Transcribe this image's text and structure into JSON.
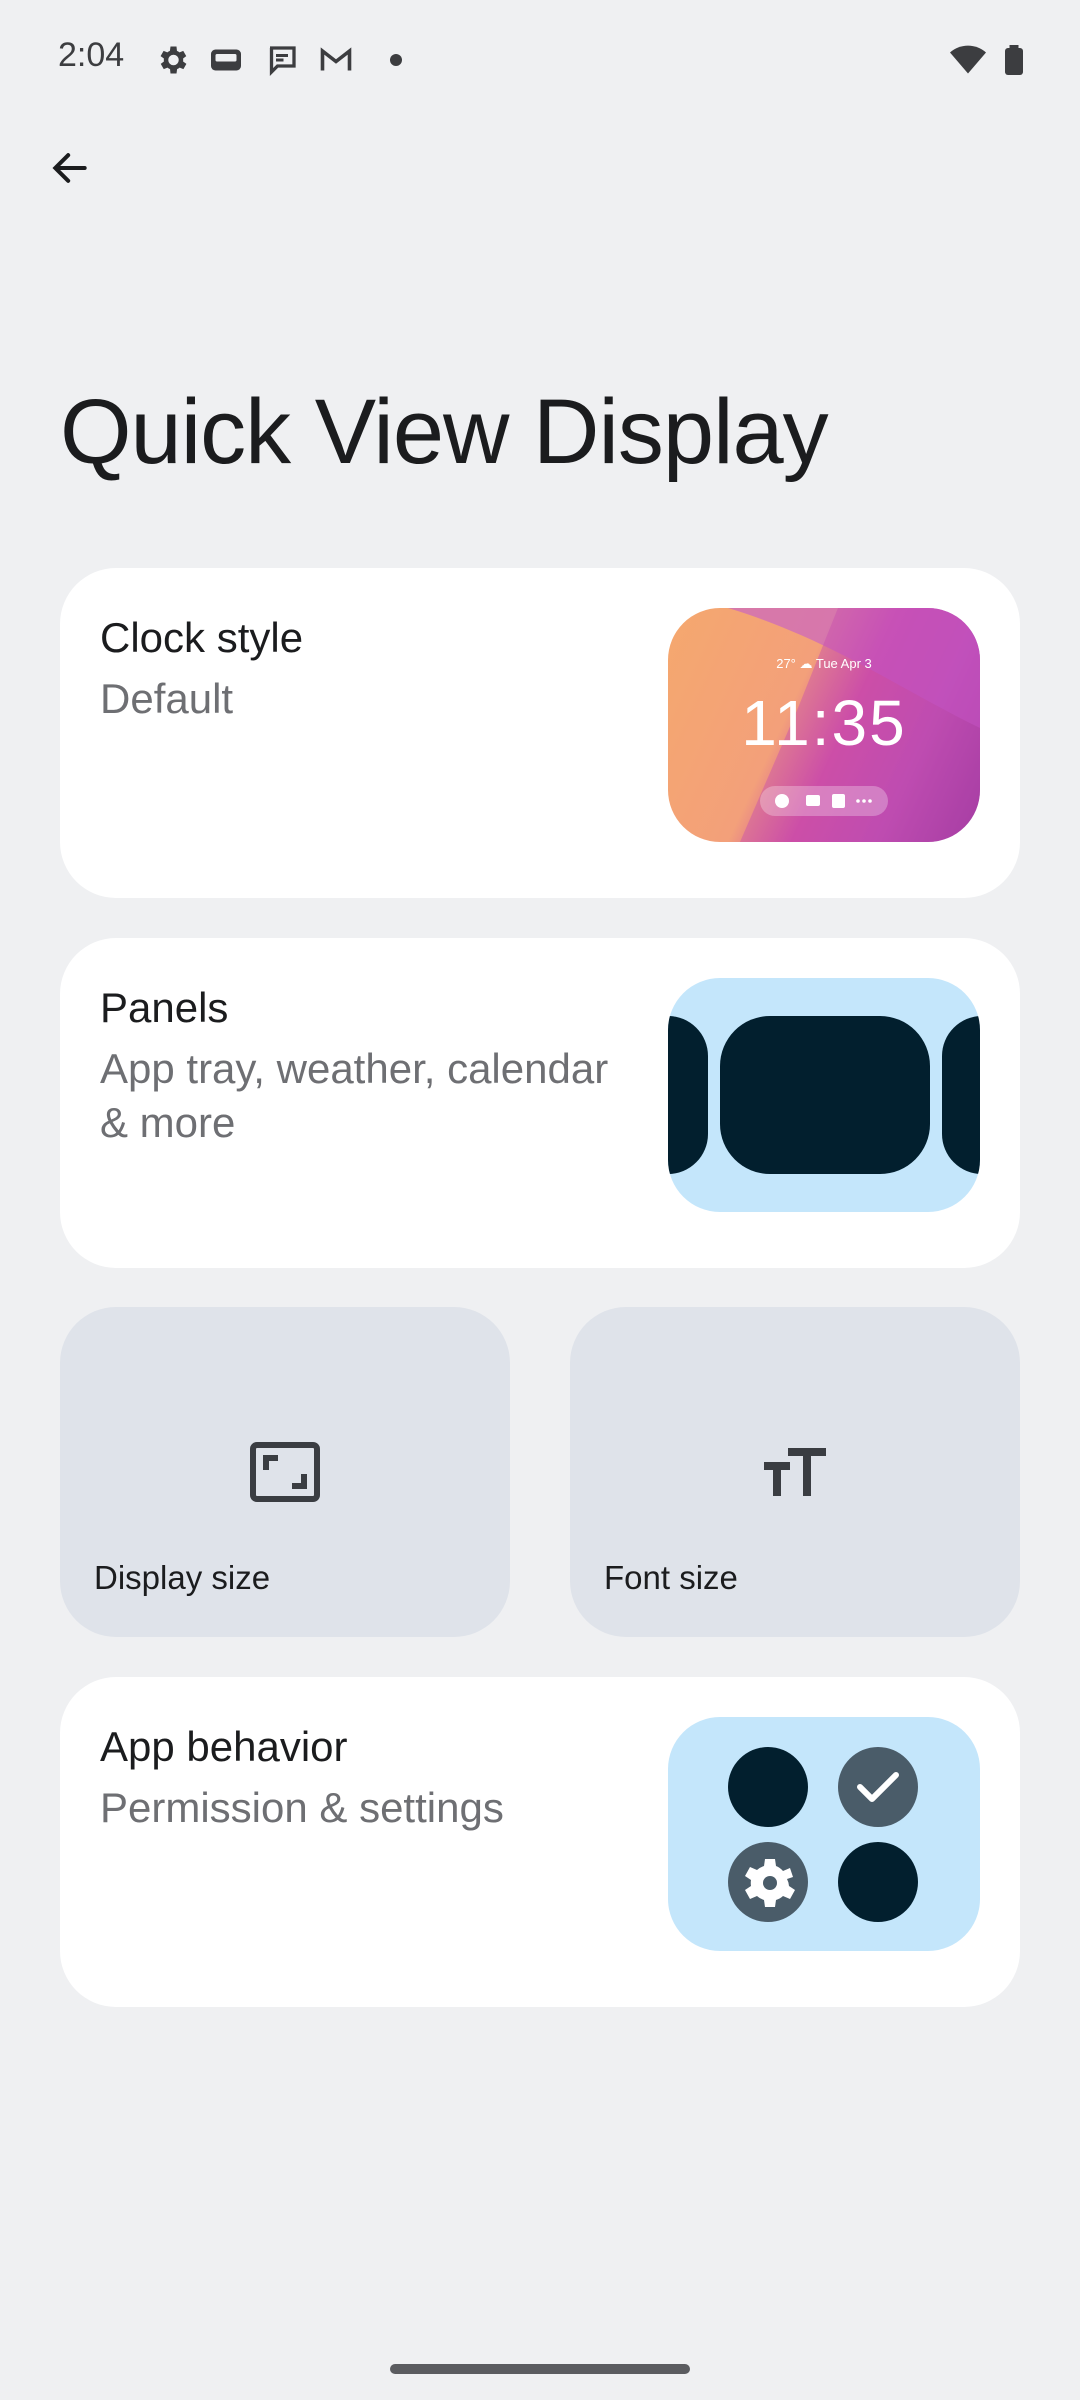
{
  "status_bar": {
    "time": "2:04",
    "icons": [
      "settings-icon",
      "cast-icon",
      "chat-icon",
      "gmail-icon",
      "dot-icon",
      "wifi-icon",
      "battery-icon"
    ]
  },
  "header": {
    "title": "Quick View Display"
  },
  "cards": {
    "clock_style": {
      "title": "Clock style",
      "subtitle": "Default",
      "preview": {
        "date": "27° ☁ Tue Apr 3",
        "time": "11:35"
      }
    },
    "panels": {
      "title": "Panels",
      "subtitle": "App tray, weather, calendar & more"
    },
    "app_behavior": {
      "title": "App behavior",
      "subtitle": "Permission & settings"
    }
  },
  "tiles": {
    "display_size": {
      "label": "Display size"
    },
    "font_size": {
      "label": "Font size"
    }
  },
  "colors": {
    "background": "#eff0f2",
    "card": "#ffffff",
    "tile": "#dfe3ea",
    "thumb_blue": "#c4e6fb",
    "dark_navy": "#021f2e"
  }
}
